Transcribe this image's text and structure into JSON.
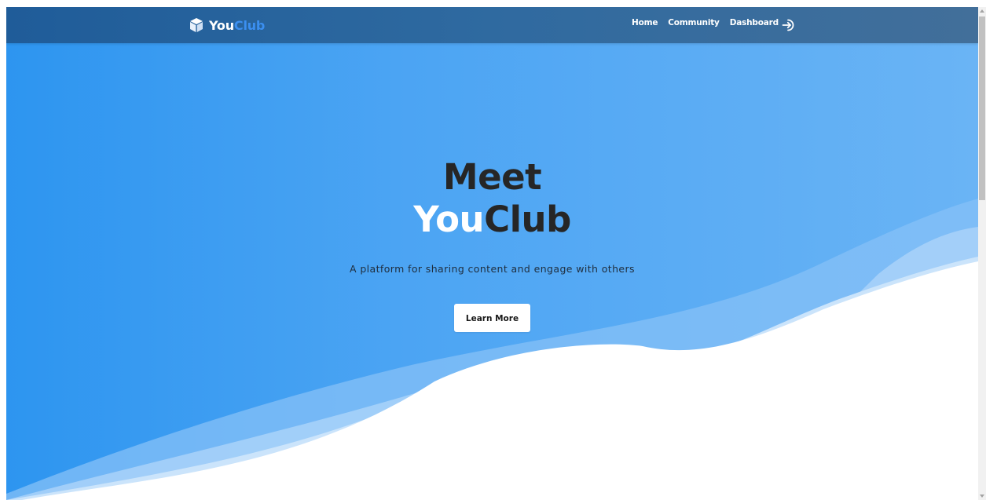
{
  "navbar": {
    "brand": {
      "part1": "You",
      "part2": "Club",
      "icon": "cube-icon"
    },
    "links": [
      "Home",
      "Community",
      "Dashboard"
    ],
    "login_icon": "sign-in-icon"
  },
  "hero": {
    "title_line1": "Meet",
    "title_part1": "You",
    "title_part2": "Club",
    "subtitle": "A platform for sharing content and engage with others",
    "cta_label": "Learn More"
  },
  "colors": {
    "accent": "#3b8ff0",
    "hero_start": "#2d95f0",
    "hero_end": "#6ab4f5",
    "navbar": "#2f6aa0",
    "title_dark": "#262626"
  }
}
